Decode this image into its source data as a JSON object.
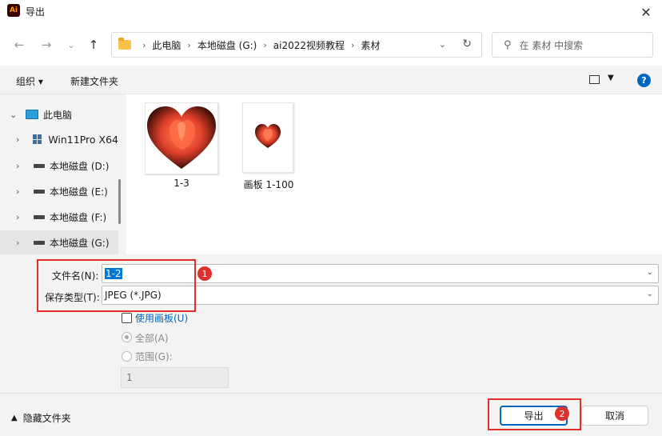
{
  "window": {
    "app_icon_text": "Ai",
    "title": "导出",
    "close_glyph": "✕"
  },
  "nav": {
    "back_glyph": "←",
    "forward_glyph": "→",
    "recent_glyph": "⌄",
    "up_glyph": "↑",
    "breadcrumbs": [
      "此电脑",
      "本地磁盘 (G:)",
      "ai2022视频教程",
      "素材"
    ],
    "breadcrumb_sep": "›",
    "search_placeholder": "在 素材 中搜索"
  },
  "toolbar": {
    "organize_label": "组织 ▾",
    "new_folder_label": "新建文件夹",
    "help_glyph": "?"
  },
  "sidebar": {
    "items": [
      {
        "label": "此电脑",
        "icon": "computer-icon",
        "expanded": true
      },
      {
        "label": "Win11Pro X64",
        "icon": "windows-drive-icon"
      },
      {
        "label": "本地磁盘 (D:)",
        "icon": "drive-icon"
      },
      {
        "label": "本地磁盘 (E:)",
        "icon": "drive-icon"
      },
      {
        "label": "本地磁盘 (F:)",
        "icon": "drive-icon"
      },
      {
        "label": "本地磁盘 (G:)",
        "icon": "drive-icon",
        "selected": true
      }
    ]
  },
  "files": [
    {
      "name": "1-3",
      "thumbnail": "heart-tulip-large"
    },
    {
      "name": "画板 1-100",
      "thumbnail": "heart-tulip-small"
    }
  ],
  "form": {
    "filename_label": "文件名(N):",
    "filename_value": "1-2",
    "filetype_label": "保存类型(T):",
    "filetype_value": "JPEG (*.JPG)",
    "use_artboards_label": "使用画板(U)",
    "use_artboards_checked": false,
    "all_label": "全部(A)",
    "range_label": "范围(G):",
    "range_value": "1",
    "selected_range_option": "全部(A)"
  },
  "footer": {
    "hide_folders_label": "隐藏文件夹",
    "export_label": "导出",
    "cancel_label": "取消"
  },
  "annotations": {
    "badge_1": "1",
    "badge_2": "2"
  },
  "colors": {
    "highlight_red": "#e0302c",
    "accent_blue": "#0067c0",
    "link_blue": "#0067c0"
  }
}
